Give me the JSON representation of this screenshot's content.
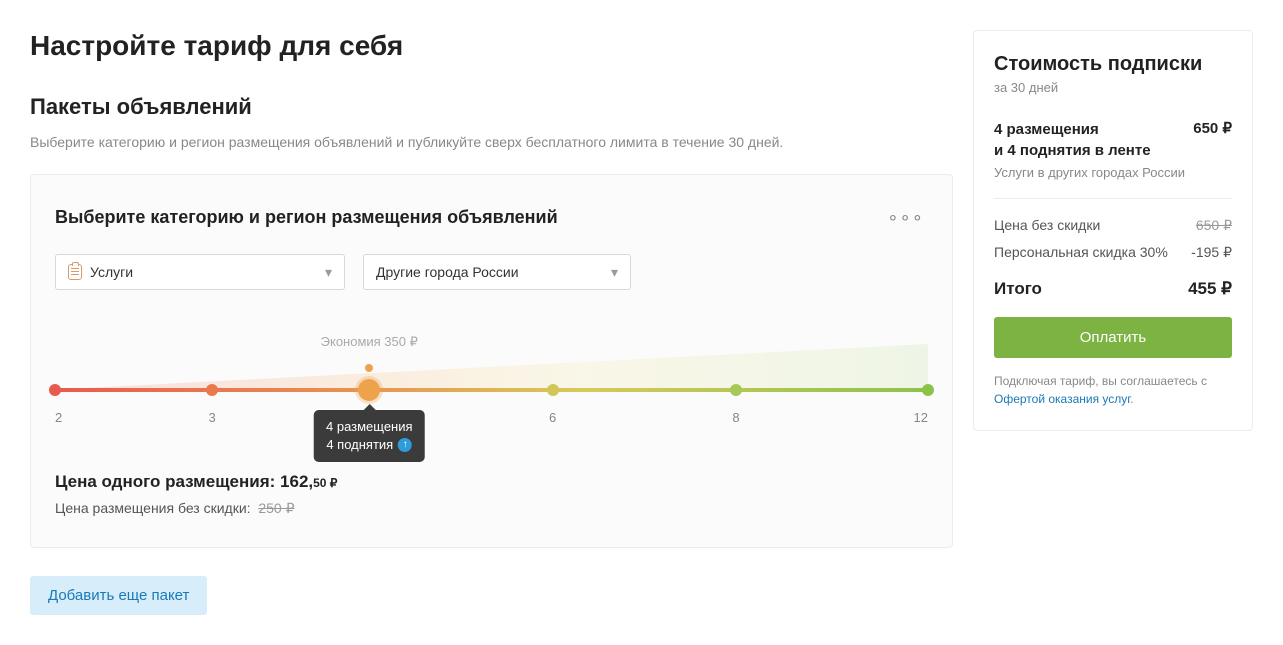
{
  "page": {
    "title": "Настройте тариф для себя",
    "section_title": "Пакеты объявлений",
    "section_subtitle": "Выберите категорию и регион размещения объявлений и публикуйте сверх бесплатного лимита в течение 30 дней."
  },
  "card": {
    "title": "Выберите категорию и регион размещения объявлений",
    "category_value": "Услуги",
    "region_value": "Другие города России",
    "savings_label": "Экономия 350 ₽",
    "slider": {
      "ticks": [
        "2",
        "3",
        "6",
        "8",
        "12"
      ],
      "selected_line1": "4 размещения",
      "selected_line2": "4 поднятия"
    },
    "price_one_label": "Цена одного размещения: ",
    "price_one_value": "162,",
    "price_one_cents": "50 ₽",
    "price_nodisc_label": "Цена размещения без скидки:",
    "price_nodisc_value": "250 ₽",
    "add_button": "Добавить еще пакет"
  },
  "sidebar": {
    "title": "Стоимость подписки",
    "period": "за 30 дней",
    "item_line1": "4 размещения",
    "item_line2": "и 4 поднятия в ленте",
    "item_sub": "Услуги в других городах России",
    "item_price": "650 ₽",
    "row_nodisc_label": "Цена без скидки",
    "row_nodisc_value": "650 ₽",
    "row_disc_label": "Персональная скидка 30%",
    "row_disc_value": "-195 ₽",
    "total_label": "Итого",
    "total_value": "455 ₽",
    "pay_button": "Оплатить",
    "disclaimer_prefix": "Подключая тариф, вы соглашаетесь с ",
    "disclaimer_link": "Офертой оказания услуг",
    "disclaimer_suffix": "."
  }
}
